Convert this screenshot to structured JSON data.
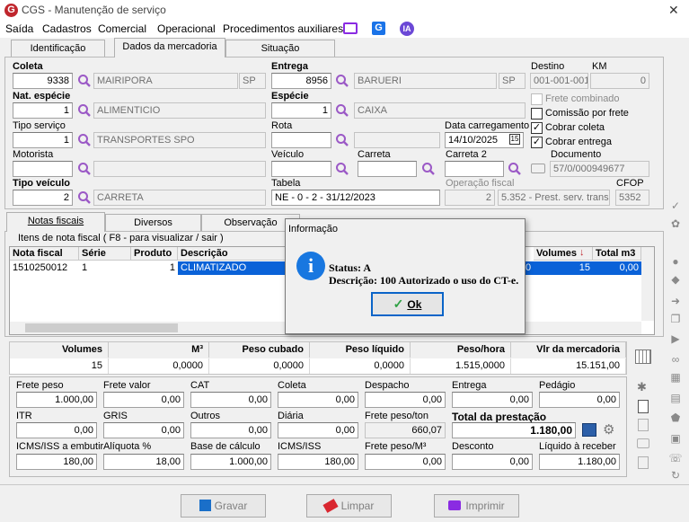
{
  "window": {
    "title": "CGS - Manutenção de serviço",
    "close": "✕"
  },
  "menu": [
    "Saída",
    "Cadastros",
    "Comercial",
    "Operacional",
    "Procedimentos auxiliares"
  ],
  "menu_icons": [
    "monitor-icon",
    "g-icon",
    "ia-icon"
  ],
  "ia": "IA",
  "g": "G",
  "tabs": [
    "Identificação",
    "Dados da mercadoria",
    "Situação"
  ],
  "form": {
    "coleta": {
      "label": "Coleta",
      "code": "9338",
      "city": "MAIRIPORA",
      "uf": "SP"
    },
    "entrega": {
      "label": "Entrega",
      "code": "8956",
      "city": "BARUERI",
      "uf": "SP"
    },
    "destino": {
      "label": "Destino",
      "value": "001-001-001"
    },
    "km": {
      "label": "KM",
      "value": "0"
    },
    "nat": {
      "label": "Nat. espécie",
      "code": "1",
      "value": "ALIMENTICIO"
    },
    "especie": {
      "label": "Espécie",
      "code": "1",
      "value": "CAIXA"
    },
    "tipo_servico": {
      "label": "Tipo serviço",
      "code": "1",
      "value": "TRANSPORTES SPO"
    },
    "rota": {
      "label": "Rota"
    },
    "data_carregamento": {
      "label": "Data carregamento",
      "value": "14/10/2025"
    },
    "motorista": {
      "label": "Motorista"
    },
    "veiculo": {
      "label": "Veículo"
    },
    "carreta": {
      "label": "Carreta"
    },
    "carreta2": {
      "label": "Carreta 2"
    },
    "documento": {
      "label": "Documento",
      "value": "57/0/000949677"
    },
    "tipo_veiculo": {
      "label": "Tipo veículo",
      "code": "2",
      "value": "CARRETA"
    },
    "tabela": {
      "label": "Tabela",
      "value": "NE - 0 - 2 - 31/12/2023"
    },
    "operacao_fiscal": {
      "label": "Operação fiscal",
      "code": "2",
      "value": "5.352 - Prest. serv. transp."
    },
    "cfop": {
      "label": "CFOP",
      "value": "5352"
    },
    "checks": [
      {
        "label": "Frete combinado",
        "checked": false,
        "disabled": true
      },
      {
        "label": "Comissão por frete",
        "checked": false,
        "disabled": false
      },
      {
        "label": "Cobrar coleta",
        "checked": true,
        "disabled": false
      },
      {
        "label": "Cobrar entrega",
        "checked": true,
        "disabled": false
      }
    ]
  },
  "subtabs": [
    "Notas fiscais",
    "Diversos",
    "Observação"
  ],
  "grid": {
    "caption": "Itens de nota fiscal ( F8 - para visualizar / sair )",
    "headers": [
      "Nota fiscal",
      "Série",
      "Produto",
      "Descrição",
      "Volumes",
      "Total m3"
    ],
    "row": {
      "nota": "1510250012",
      "serie": "1",
      "produto": "1",
      "descricao": "CLIMATIZADO",
      "partial": "0",
      "volumes": "15",
      "total": "0,00"
    }
  },
  "totals": {
    "headers": [
      "Volumes",
      "M³",
      "Peso cubado",
      "Peso líquido",
      "Peso/hora",
      "Vlr da mercadoria"
    ],
    "values": [
      "15",
      "0,0000",
      "0,0000",
      "0,0000",
      "1.515,0000",
      "15.151,00"
    ]
  },
  "calc": {
    "row1": [
      {
        "label": "Frete peso",
        "value": "1.000,00"
      },
      {
        "label": "Frete valor",
        "value": "0,00"
      },
      {
        "label": "CAT",
        "value": "0,00"
      },
      {
        "label": "Coleta",
        "value": "0,00"
      },
      {
        "label": "Despacho",
        "value": "0,00"
      },
      {
        "label": "Entrega",
        "value": "0,00"
      },
      {
        "label": "Pedágio",
        "value": "0,00"
      }
    ],
    "row2": [
      {
        "label": "ITR",
        "value": "0,00"
      },
      {
        "label": "GRIS",
        "value": "0,00"
      },
      {
        "label": "Outros",
        "value": "0,00"
      },
      {
        "label": "Diária",
        "value": "0,00"
      },
      {
        "label": "Frete peso/ton",
        "value": "660,07"
      },
      {
        "label": "Total da prestação",
        "value": "1.180,00"
      }
    ],
    "row3": [
      {
        "label": "ICMS/ISS a embutir",
        "value": "180,00"
      },
      {
        "label": "Alíquota %",
        "value": "18,00"
      },
      {
        "label": "Base de cálculo",
        "value": "1.000,00"
      },
      {
        "label": "ICMS/ISS",
        "value": "180,00"
      },
      {
        "label": "Frete peso/M³",
        "value": "0,00"
      },
      {
        "label": "Desconto",
        "value": "0,00"
      },
      {
        "label": "Líquido à receber",
        "value": "1.180,00"
      }
    ]
  },
  "buttons": {
    "gravar": "Gravar",
    "limpar": "Limpar",
    "imprimir": "Imprimir"
  },
  "dialog": {
    "title": "Informação",
    "status_label": "Status:",
    "status_value": "A",
    "desc_label": "Descrição:",
    "desc_value": "100 Autorizado o uso do CT-e.",
    "ok": "Ok"
  },
  "colors": {
    "accent": "#0078d7",
    "brand": "#c0262d",
    "selection": "#0a62d8",
    "dialog_ok_border": "#0a64c8"
  }
}
